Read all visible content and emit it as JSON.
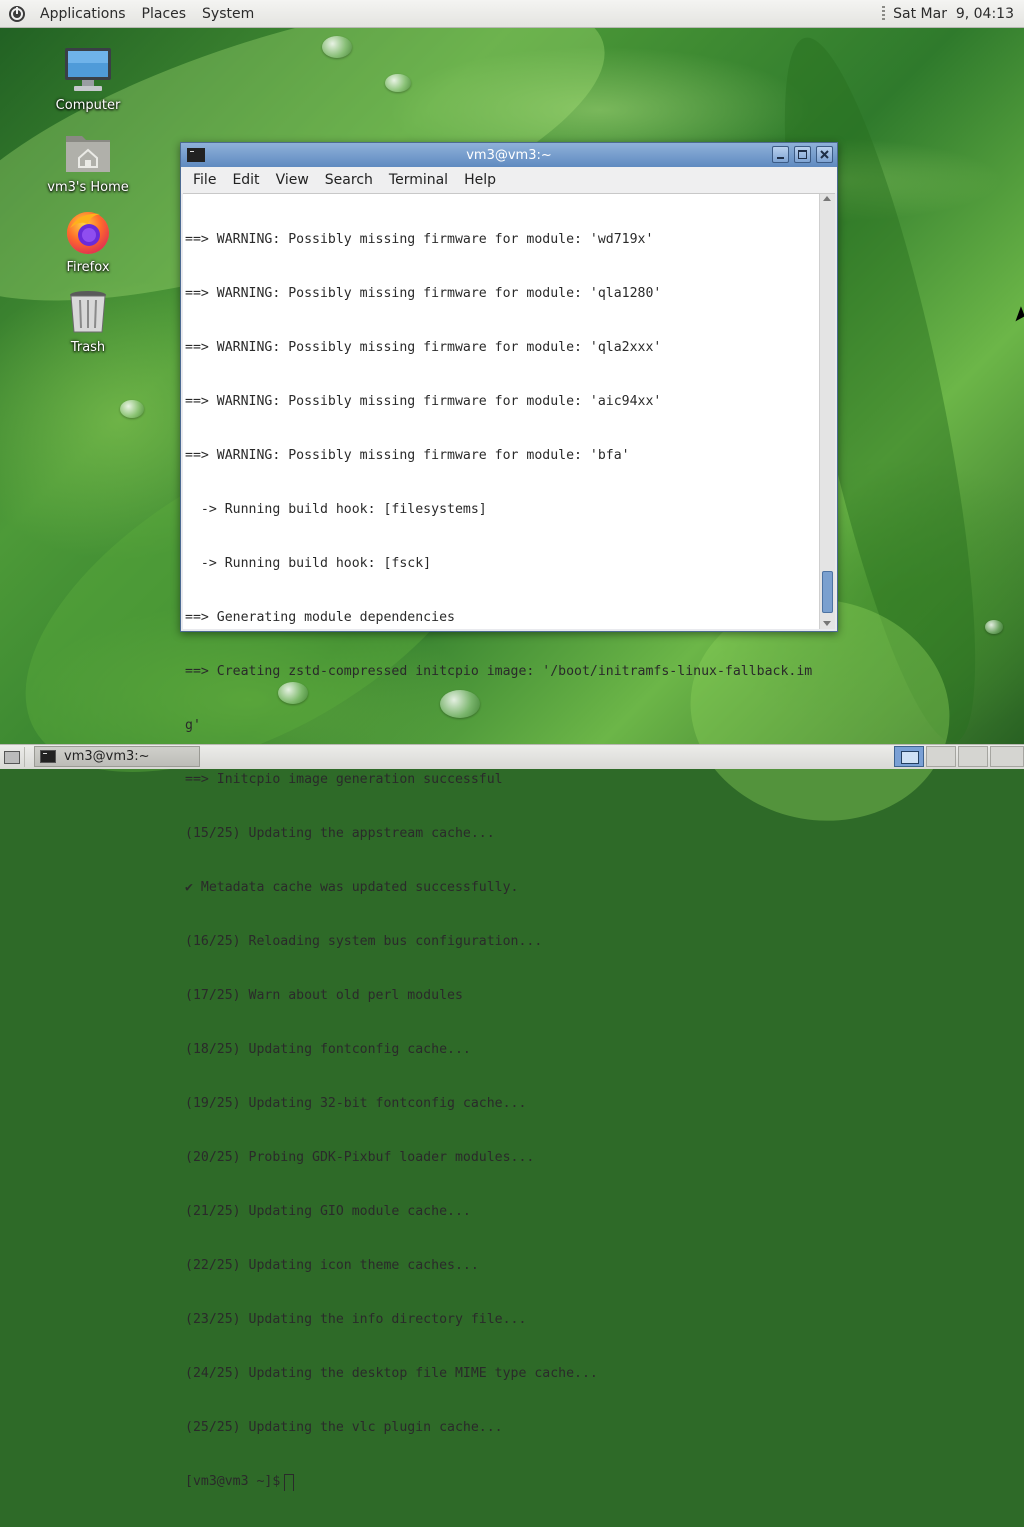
{
  "top_panel": {
    "menus": [
      "Applications",
      "Places",
      "System"
    ],
    "clock": "Sat Mar  9, 04:13"
  },
  "desktop_icons": [
    {
      "label": "Computer",
      "icon": "computer-icon"
    },
    {
      "label": "vm3's Home",
      "icon": "home-folder-icon"
    },
    {
      "label": "Firefox",
      "icon": "firefox-icon"
    },
    {
      "label": "Trash",
      "icon": "trash-icon"
    }
  ],
  "terminal": {
    "title": "vm3@vm3:~",
    "menu": [
      "File",
      "Edit",
      "View",
      "Search",
      "Terminal",
      "Help"
    ],
    "lines": [
      "==> WARNING: Possibly missing firmware for module: 'wd719x'",
      "==> WARNING: Possibly missing firmware for module: 'qla1280'",
      "==> WARNING: Possibly missing firmware for module: 'qla2xxx'",
      "==> WARNING: Possibly missing firmware for module: 'aic94xx'",
      "==> WARNING: Possibly missing firmware for module: 'bfa'",
      "  -> Running build hook: [filesystems]",
      "  -> Running build hook: [fsck]",
      "==> Generating module dependencies",
      "==> Creating zstd-compressed initcpio image: '/boot/initramfs-linux-fallback.im",
      "g'",
      "==> Initcpio image generation successful",
      "(15/25) Updating the appstream cache...",
      "✔ Metadata cache was updated successfully.",
      "(16/25) Reloading system bus configuration...",
      "(17/25) Warn about old perl modules",
      "(18/25) Updating fontconfig cache...",
      "(19/25) Updating 32-bit fontconfig cache...",
      "(20/25) Probing GDK-Pixbuf loader modules...",
      "(21/25) Updating GIO module cache...",
      "(22/25) Updating icon theme caches...",
      "(23/25) Updating the info directory file...",
      "(24/25) Updating the desktop file MIME type cache...",
      "(25/25) Updating the vlc plugin cache..."
    ],
    "prompt": "[vm3@vm3 ~]$"
  },
  "bottom_panel": {
    "task_label": "vm3@vm3:~",
    "workspaces": 4,
    "active_workspace": 1
  },
  "colors": {
    "titlebar": "#6f97c9",
    "panel": "#e8e8e5",
    "terminal_bg": "#ffffff"
  }
}
